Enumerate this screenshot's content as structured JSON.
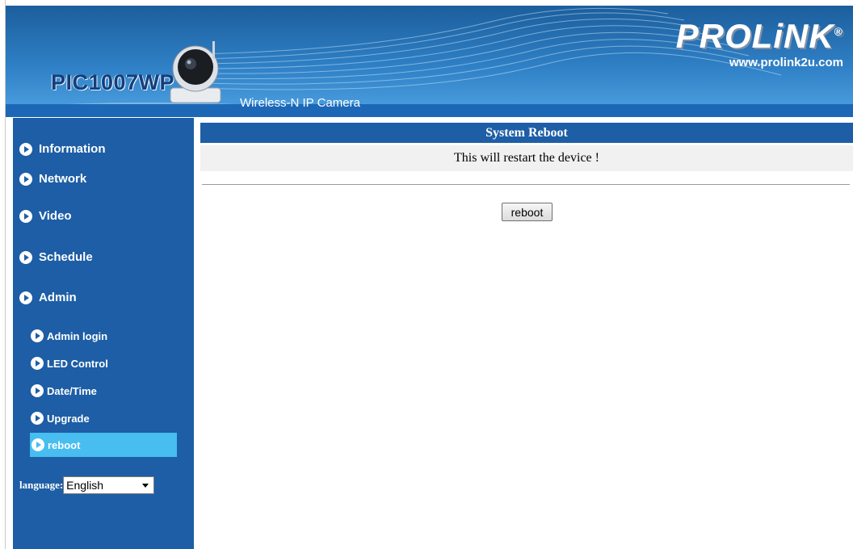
{
  "header": {
    "model": "PIC1007WP",
    "subtitle": "Wireless-N IP Camera",
    "brand": "PROLiNK",
    "brand_mark": "®",
    "url": "www.prolink2u.com"
  },
  "sidebar": {
    "items": [
      {
        "label": "Information"
      },
      {
        "label": "Network"
      },
      {
        "label": "Video"
      },
      {
        "label": "Schedule"
      },
      {
        "label": "Admin"
      }
    ],
    "admin_items": [
      {
        "label": "Admin login"
      },
      {
        "label": "LED Control"
      },
      {
        "label": "Date/Time"
      },
      {
        "label": "Upgrade"
      },
      {
        "label": "reboot",
        "active": true
      }
    ],
    "language_label": "language:",
    "language_value": "English"
  },
  "main": {
    "title": "System Reboot",
    "message": "This will restart the device !",
    "button_label": "reboot"
  },
  "colors": {
    "nav_blue": "#1d5ea6",
    "active_item": "#47bdf0",
    "info_bg": "#f1f1f1"
  }
}
